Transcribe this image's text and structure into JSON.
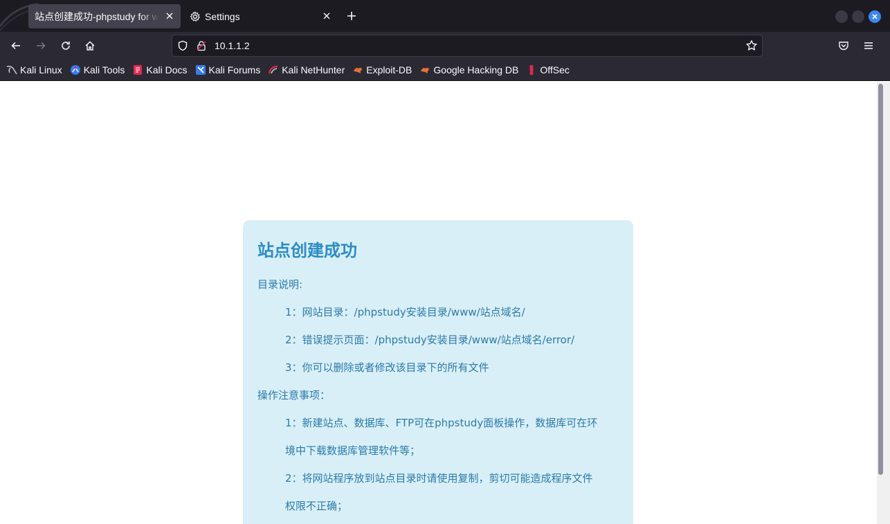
{
  "tabs": [
    {
      "title": "站点创建成功-phpstudy for windows",
      "active": true
    },
    {
      "title": "Settings",
      "active": false
    }
  ],
  "url": "10.1.1.2",
  "bookmarks": [
    {
      "label": "Kali Linux",
      "icon": "kali-dragon-icon"
    },
    {
      "label": "Kali Tools",
      "icon": "kali-tools-icon"
    },
    {
      "label": "Kali Docs",
      "icon": "kali-docs-icon"
    },
    {
      "label": "Kali Forums",
      "icon": "kali-forums-icon"
    },
    {
      "label": "Kali NetHunter",
      "icon": "nethunter-icon"
    },
    {
      "label": "Exploit-DB",
      "icon": "exploit-db-icon"
    },
    {
      "label": "Google Hacking DB",
      "icon": "ghdb-icon"
    },
    {
      "label": "OffSec",
      "icon": "offsec-icon"
    }
  ],
  "page": {
    "heading": "站点创建成功",
    "dir_title": "目录说明:",
    "dir_items": [
      "1：网站目录：/phpstudy安装目录/www/站点域名/",
      "2：错误提示页面：/phpstudy安装目录/www/站点域名/error/",
      "3：你可以删除或者修改该目录下的所有文件"
    ],
    "ops_title": "操作注意事项：",
    "ops_lines": [
      "1：新建站点、数据库、FTP可在phpstudy面板操作，数据库可在环",
      "境中下载数据库管理软件等；",
      "2：将网站程序放到站点目录时请使用复制，剪切可能造成程序文件",
      "权限不正确；"
    ]
  },
  "colors": {
    "card_bg": "#d9eff8",
    "heading": "#2b8cc4",
    "text": "#2b7aa8",
    "accent": "#3c86f2"
  }
}
